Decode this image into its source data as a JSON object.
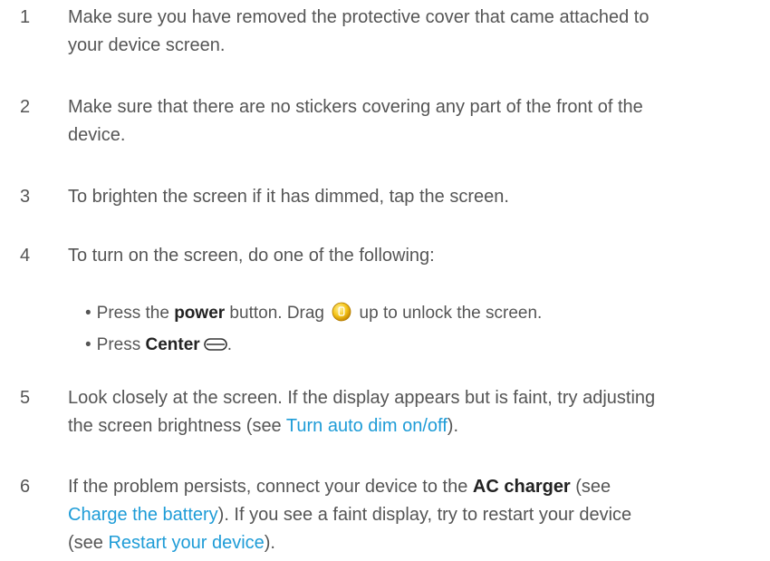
{
  "steps": [
    {
      "num": "1",
      "text": "Make sure you have removed the protective cover that came attached to your device screen."
    },
    {
      "num": "2",
      "text": "Make sure that there are no stickers covering any part of the front of the device."
    },
    {
      "num": "3",
      "text": "To brighten the screen if it has dimmed, tap the screen."
    },
    {
      "num": "4",
      "text": "To turn on the screen, do one of the following:"
    },
    {
      "num": "5",
      "text_a": "Look closely at the screen. If the display appears but is faint, try adjusting the screen brightness (see ",
      "link": "Turn auto dim on/off",
      "text_b": ")."
    },
    {
      "num": "6",
      "text_a": "If the problem persists, connect your device to the ",
      "bold": "AC charger",
      "text_b": " (see ",
      "link1": "Charge the battery",
      "text_c": "). If you see a faint display, try to restart your device (see ",
      "link2": "Restart your device",
      "text_d": ")."
    }
  ],
  "bullets": [
    {
      "dot": "•",
      "pre": "Press the ",
      "bold": "power",
      "mid": " button. Drag ",
      "icon": "unlock-icon",
      "post": " up to unlock the screen."
    },
    {
      "dot": "•",
      "pre": "Press ",
      "bold": "Center",
      "icon": "center-button-icon",
      "post": "."
    }
  ],
  "colors": {
    "text": "#555555",
    "link": "#1e9cd7",
    "bold": "#222222"
  }
}
